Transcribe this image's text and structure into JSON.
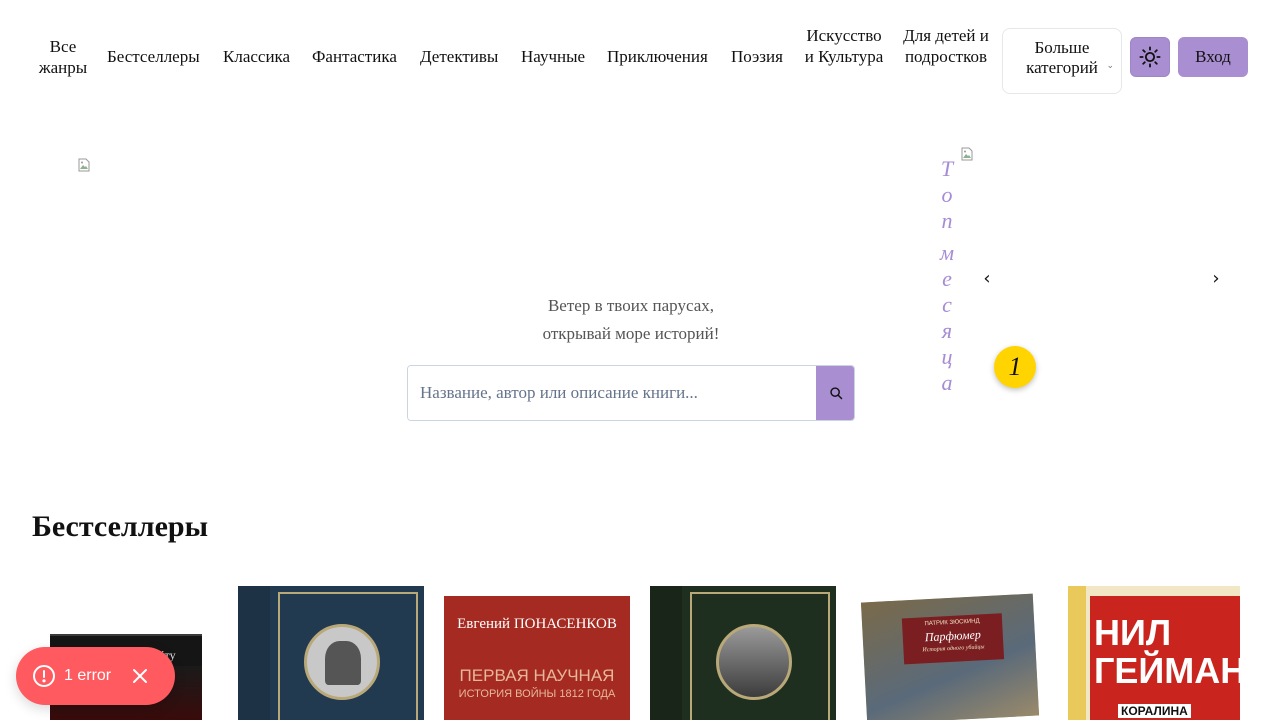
{
  "nav": {
    "items": [
      {
        "label": "Все жанры"
      },
      {
        "label": "Бестселлеры"
      },
      {
        "label": "Классика"
      },
      {
        "label": "Фантастика"
      },
      {
        "label": "Детективы"
      },
      {
        "label": "Научные"
      },
      {
        "label": "Приключения"
      },
      {
        "label": "Поэзия"
      },
      {
        "label": "Искусство и Культура"
      },
      {
        "label": "Для детей и подростков"
      }
    ],
    "more_label": "Больше категорий",
    "theme_icon": "sun-icon",
    "login_label": "Вход"
  },
  "hero": {
    "tagline_line1": "Ветер в твоих парусах,",
    "tagline_line2": "открывай море историй!",
    "search_placeholder": "Название, автор или описание книги...",
    "search_icon": "search-icon"
  },
  "top_month": {
    "label": "Топ месяца",
    "rank": "1"
  },
  "bestsellers": {
    "title": "Бестселлеры",
    "books": [
      {
        "author": "",
        "title": "по Фаренгейту",
        "cover_color": "#151515"
      },
      {
        "author": "",
        "title": "",
        "cover_color": "#223a4f"
      },
      {
        "author": "Евгений ПОНАСЕНКОВ",
        "title": "ПЕРВАЯ НАУЧНАЯ",
        "subtitle": "ИСТОРИЯ ВОЙНЫ 1812 ГОДА",
        "cover_color": "#a42a22"
      },
      {
        "author": "",
        "title": "",
        "cover_color": "#1f2f1f"
      },
      {
        "author": "ПАТРИК ЗЮСКИНД",
        "title": "Парфюмер",
        "subtitle": "История одного убийцы",
        "cover_color": "#7a1e22"
      },
      {
        "author": "НИЛ ГЕЙМАН",
        "title": "КОРАЛИНА",
        "cover_color": "#c9251e"
      }
    ]
  },
  "toast": {
    "text": "1 error",
    "accent": "#ff5a5f"
  },
  "colors": {
    "accent": "#a98fd1",
    "top_month": "#a78bd4",
    "badge": "#ffd400"
  }
}
